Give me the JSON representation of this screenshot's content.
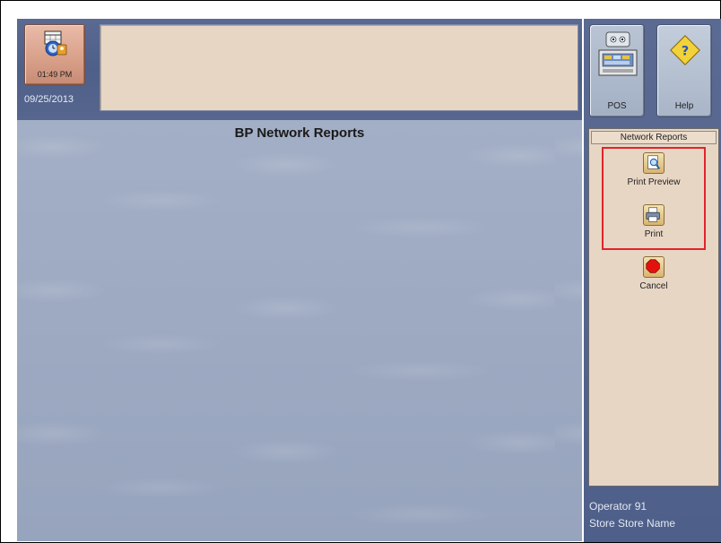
{
  "header": {
    "clock_time": "01:49 PM",
    "date": "09/25/2013",
    "message": ""
  },
  "main": {
    "title": "BP Network Reports"
  },
  "toolbar": {
    "pos_label": "POS",
    "help_label": "Help"
  },
  "action_panel": {
    "title": "Network Reports",
    "items": [
      {
        "label": "Print Preview",
        "icon": "magnifier-icon"
      },
      {
        "label": "Print",
        "icon": "printer-icon"
      },
      {
        "label": "Cancel",
        "icon": "stop-icon"
      }
    ],
    "highlight_color": "#e0242c"
  },
  "status": {
    "operator": "Operator 91",
    "store": "Store Store Name"
  }
}
